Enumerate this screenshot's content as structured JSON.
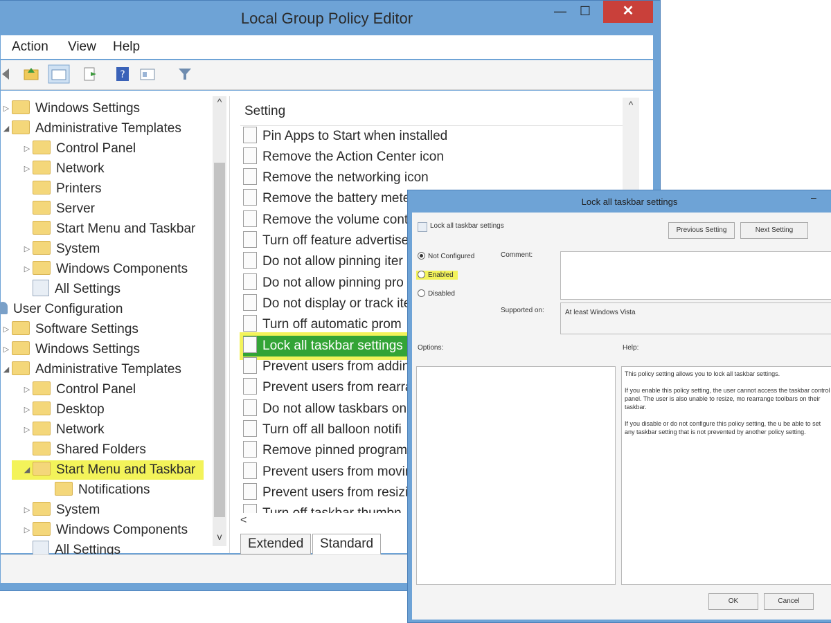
{
  "window": {
    "title": "Local Group Policy Editor",
    "min_glyph": "—",
    "max_glyph": "☐",
    "close_glyph": "✕"
  },
  "menu": [
    "Action",
    "View",
    "Help"
  ],
  "toolbar_icons": [
    "back-icon",
    "up-folder-icon",
    "show-hide-tree-icon",
    "export-list-icon",
    "help-icon",
    "properties-icon",
    "filter-icon"
  ],
  "tree": [
    {
      "label": "Windows Settings",
      "arrow": "▷"
    },
    {
      "label": "Administrative Templates",
      "arrow": "◢"
    },
    {
      "label": "Control Panel",
      "arrow": "▷"
    },
    {
      "label": "Network",
      "arrow": "▷"
    },
    {
      "label": "Printers",
      "arrow": ""
    },
    {
      "label": "Server",
      "arrow": ""
    },
    {
      "label": "Start Menu and Taskbar",
      "arrow": ""
    },
    {
      "label": "System",
      "arrow": "▷"
    },
    {
      "label": "Windows Components",
      "arrow": "▷"
    },
    {
      "label": "All Settings",
      "arrow": ""
    },
    {
      "label": "User Configuration",
      "arrow": "◢"
    },
    {
      "label": "Software Settings",
      "arrow": "▷"
    },
    {
      "label": "Windows Settings",
      "arrow": "▷"
    },
    {
      "label": "Administrative Templates",
      "arrow": "◢"
    },
    {
      "label": "Control Panel",
      "arrow": "▷"
    },
    {
      "label": "Desktop",
      "arrow": "▷"
    },
    {
      "label": "Network",
      "arrow": "▷"
    },
    {
      "label": "Shared Folders",
      "arrow": ""
    },
    {
      "label": "Start Menu and Taskbar",
      "arrow": "◢"
    },
    {
      "label": "Notifications",
      "arrow": ""
    },
    {
      "label": "System",
      "arrow": "▷"
    },
    {
      "label": "Windows Components",
      "arrow": "▷"
    },
    {
      "label": "All Settings",
      "arrow": ""
    }
  ],
  "tree_scroll": {
    "up": "^",
    "down": "v"
  },
  "settings": {
    "header": "Setting",
    "items": [
      "Pin Apps to Start when installed",
      "Remove the Action Center icon",
      "Remove the networking icon",
      "Remove the battery mete",
      "Remove the volume cont",
      "Turn off feature advertise",
      "Do not allow pinning iter",
      "Do not allow pinning pro",
      "Do not display or track ite",
      "Turn off automatic prom",
      "Lock all taskbar settings",
      "Prevent users from addin",
      "Prevent users from rearra",
      "Do not allow taskbars on",
      "Turn off all balloon notifi",
      "Remove pinned program",
      "Prevent users from movin",
      "Prevent users from resizir",
      "Turn off taskbar thumbn"
    ],
    "scroll_up": "^",
    "scroll_left": "<"
  },
  "tabs": [
    "Extended",
    "Standard"
  ],
  "dialog": {
    "title": "Lock all taskbar settings",
    "min_glyph": "–",
    "setting_name": "Lock all taskbar settings",
    "prev_button": "Previous Setting",
    "next_button": "Next Setting",
    "radio": {
      "not_configured": "Not Configured",
      "enabled": "Enabled",
      "disabled": "Disabled",
      "selected": "Not Configured"
    },
    "comment_label": "Comment:",
    "supported_label": "Supported on:",
    "supported_value": "At least Windows Vista",
    "options_label": "Options:",
    "help_label": "Help:",
    "help_paragraphs": [
      "This policy setting allows you to lock all taskbar settings.",
      "If you enable this policy setting, the user cannot access the taskbar control panel. The user is also unable to resize, mo rearrange toolbars on their taskbar.",
      "If you disable or do not configure this policy setting, the u be able to set any taskbar setting that is not prevented by another policy setting."
    ],
    "ok_button": "OK",
    "cancel_button": "Cancel"
  },
  "colors": {
    "selection_green": "#33a436",
    "highlight_yellow": "#f3f35a",
    "window_frame": "#6ea3d6",
    "close_red": "#c9403a"
  }
}
